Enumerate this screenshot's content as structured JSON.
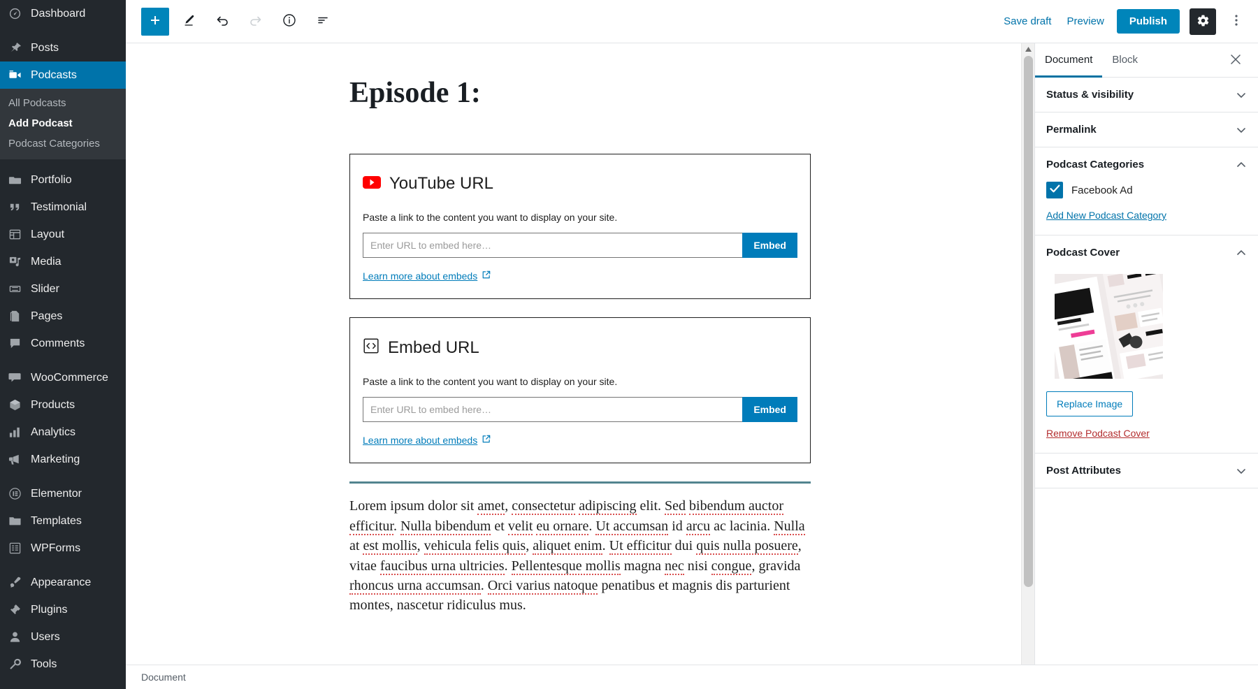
{
  "admin_menu": {
    "groups": [
      {
        "items": [
          {
            "label": "Dashboard",
            "icon": "dashboard-icon",
            "current": false
          }
        ]
      },
      {
        "items": [
          {
            "label": "Posts",
            "icon": "pin-icon",
            "current": false
          },
          {
            "label": "Podcasts",
            "icon": "video-camera-icon",
            "current": true
          }
        ]
      },
      {
        "items": [
          {
            "label": "Portfolio",
            "icon": "portfolio-icon",
            "current": false
          },
          {
            "label": "Testimonial",
            "icon": "quote-icon",
            "current": false
          },
          {
            "label": "Layout",
            "icon": "layout-icon",
            "current": false
          },
          {
            "label": "Media",
            "icon": "media-icon",
            "current": false
          },
          {
            "label": "Slider",
            "icon": "slider-icon",
            "current": false
          },
          {
            "label": "Pages",
            "icon": "pages-icon",
            "current": false
          },
          {
            "label": "Comments",
            "icon": "comment-icon",
            "current": false
          }
        ]
      },
      {
        "items": [
          {
            "label": "WooCommerce",
            "icon": "woocommerce-icon",
            "current": false
          },
          {
            "label": "Products",
            "icon": "products-icon",
            "current": false
          },
          {
            "label": "Analytics",
            "icon": "analytics-icon",
            "current": false
          },
          {
            "label": "Marketing",
            "icon": "megaphone-icon",
            "current": false
          }
        ]
      },
      {
        "items": [
          {
            "label": "Elementor",
            "icon": "elementor-icon",
            "current": false
          },
          {
            "label": "Templates",
            "icon": "folder-icon",
            "current": false
          },
          {
            "label": "WPForms",
            "icon": "wpforms-icon",
            "current": false
          }
        ]
      },
      {
        "items": [
          {
            "label": "Appearance",
            "icon": "brush-icon",
            "current": false
          },
          {
            "label": "Plugins",
            "icon": "plugin-icon",
            "current": false
          },
          {
            "label": "Users",
            "icon": "user-icon",
            "current": false
          },
          {
            "label": "Tools",
            "icon": "wrench-icon",
            "current": false
          }
        ]
      }
    ],
    "podcasts_submenu": [
      {
        "label": "All Podcasts",
        "current": false
      },
      {
        "label": "Add Podcast",
        "current": true
      },
      {
        "label": "Podcast Categories",
        "current": false
      }
    ]
  },
  "toolbar": {
    "add_block_icon": "plus-icon",
    "edit_icon": "pencil-icon",
    "undo_icon": "undo-arrow-icon",
    "redo_icon": "redo-arrow-icon",
    "info_icon": "info-circle-icon",
    "block_nav_icon": "block-navigation-icon",
    "save_draft_label": "Save draft",
    "preview_label": "Preview",
    "publish_label": "Publish",
    "settings_icon": "gear-icon",
    "more_icon": "kebab-menu-icon"
  },
  "editor": {
    "post_title": "Episode 1:",
    "blocks": [
      {
        "icon": "youtube-icon",
        "title": "YouTube URL",
        "description": "Paste a link to the content you want to display on your site.",
        "input_value": "",
        "input_placeholder": "Enter URL to embed here…",
        "submit_label": "Embed",
        "learn_more_label": "Learn more about embeds",
        "external_icon": "external-link-icon"
      },
      {
        "icon": "embed-code-icon",
        "title": "Embed URL",
        "description": "Paste a link to the content you want to display on your site.",
        "input_value": "",
        "input_placeholder": "Enter URL to embed here…",
        "submit_label": "Embed",
        "learn_more_label": "Learn more about embeds",
        "external_icon": "external-link-icon"
      }
    ],
    "paragraph_segments": [
      {
        "t": "Lorem ipsum dolor sit ",
        "sp": false
      },
      {
        "t": "amet",
        "sp": true
      },
      {
        "t": ", ",
        "sp": false
      },
      {
        "t": "consectetur",
        "sp": true
      },
      {
        "t": " ",
        "sp": false
      },
      {
        "t": "adipiscing",
        "sp": true
      },
      {
        "t": " elit. ",
        "sp": false
      },
      {
        "t": "Sed",
        "sp": true
      },
      {
        "t": " ",
        "sp": false
      },
      {
        "t": "bibendum auctor efficitur",
        "sp": true
      },
      {
        "t": ". ",
        "sp": false
      },
      {
        "t": "Nulla bibendum",
        "sp": true
      },
      {
        "t": " et ",
        "sp": false
      },
      {
        "t": "velit",
        "sp": true
      },
      {
        "t": " ",
        "sp": false
      },
      {
        "t": "eu ornare",
        "sp": true
      },
      {
        "t": ". ",
        "sp": false
      },
      {
        "t": "Ut accumsan",
        "sp": true
      },
      {
        "t": " id ",
        "sp": false
      },
      {
        "t": "arcu",
        "sp": true
      },
      {
        "t": " ac lacinia. ",
        "sp": false
      },
      {
        "t": "Nulla",
        "sp": true
      },
      {
        "t": " at ",
        "sp": false
      },
      {
        "t": "est mollis",
        "sp": true
      },
      {
        "t": ", ",
        "sp": false
      },
      {
        "t": "vehicula felis quis",
        "sp": true
      },
      {
        "t": ", ",
        "sp": false
      },
      {
        "t": "aliquet enim",
        "sp": true
      },
      {
        "t": ". ",
        "sp": false
      },
      {
        "t": "Ut efficitur",
        "sp": true
      },
      {
        "t": " dui ",
        "sp": false
      },
      {
        "t": "quis nulla posuere",
        "sp": true
      },
      {
        "t": ", vitae ",
        "sp": false
      },
      {
        "t": "faucibus urna ultricies",
        "sp": true
      },
      {
        "t": ". ",
        "sp": false
      },
      {
        "t": "Pellentesque mollis",
        "sp": true
      },
      {
        "t": " magna ",
        "sp": false
      },
      {
        "t": "nec",
        "sp": true
      },
      {
        "t": " nisi ",
        "sp": false
      },
      {
        "t": "congue",
        "sp": true
      },
      {
        "t": ", gravida ",
        "sp": false
      },
      {
        "t": "rhoncus urna accumsan",
        "sp": true
      },
      {
        "t": ". ",
        "sp": false
      },
      {
        "t": "Orci varius natoque",
        "sp": true
      },
      {
        "t": " penatibus et magnis dis parturient montes, nascetur ridiculus mus.",
        "sp": false
      }
    ]
  },
  "settings_sidebar": {
    "tabs": [
      {
        "label": "Document",
        "active": true
      },
      {
        "label": "Block",
        "active": false
      }
    ],
    "close_icon": "close-icon",
    "panels": [
      {
        "title": "Status & visibility",
        "expanded": false,
        "chevron": "chevron-down-icon"
      },
      {
        "title": "Permalink",
        "expanded": false,
        "chevron": "chevron-down-icon"
      },
      {
        "title": "Podcast Categories",
        "expanded": true,
        "chevron": "chevron-up-icon"
      },
      {
        "title": "Podcast Cover",
        "expanded": true,
        "chevron": "chevron-up-icon"
      },
      {
        "title": "Post Attributes",
        "expanded": false,
        "chevron": "chevron-down-icon"
      }
    ],
    "podcast_categories": {
      "items": [
        {
          "label": "Facebook Ad",
          "checked": true
        }
      ],
      "add_new_label": "Add New Podcast Category"
    },
    "podcast_cover": {
      "image_alt": "podcast-cover-thumbnail",
      "replace_label": "Replace Image",
      "remove_label": "Remove Podcast Cover"
    }
  },
  "status_bar": {
    "breadcrumb": "Document"
  },
  "colors": {
    "admin_bg": "#23282d",
    "admin_submenu_bg": "#32373c",
    "accent_blue": "#0073aa",
    "publish_blue": "#0085ba",
    "embed_blue": "#007cba",
    "youtube_red": "#ff0000",
    "divider_teal": "#52848f",
    "danger_red": "#b32d2e",
    "spellcheck_red": "#d94f4f"
  }
}
